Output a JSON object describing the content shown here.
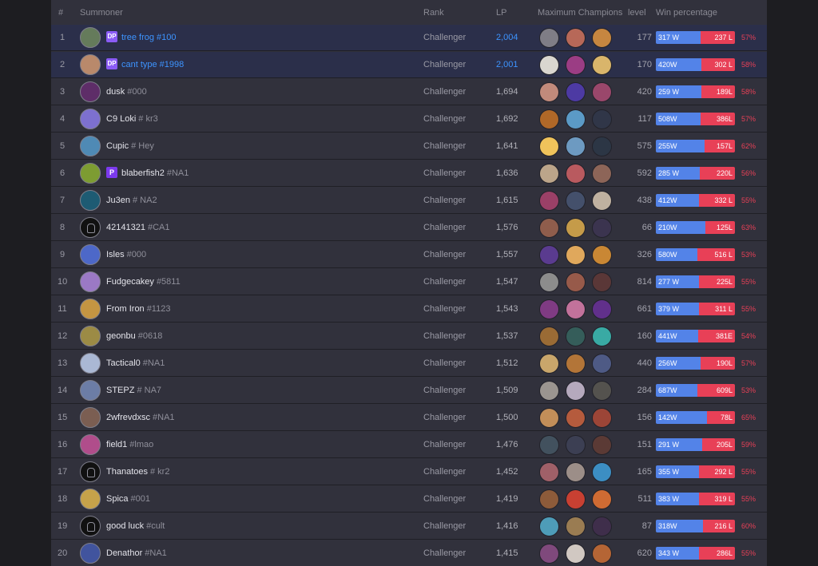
{
  "header": {
    "rank": "#",
    "summoner": "Summoner",
    "tier": "Rank",
    "lp": "LP",
    "champions": "Maximum Champions",
    "level": "level",
    "win": "Win percentage"
  },
  "rows": [
    {
      "rank": "1",
      "name": "tree frog",
      "tag": "#100",
      "badge": "DP",
      "tier": "Challenger",
      "lp": "2,004",
      "level": "177",
      "wins": "317 W",
      "losses": "237 L",
      "pct": "57%",
      "win_rate": 0.57,
      "highlight": true,
      "avatar_icon": "frog-avatar-icon",
      "avatar_color": "#657b5b",
      "champs": [
        {
          "icon": "champion-portrait-icon",
          "color": "#7f7d86"
        },
        {
          "icon": "champion-portrait-icon",
          "color": "#b76858"
        },
        {
          "icon": "champion-portrait-icon",
          "color": "#c68640"
        }
      ]
    },
    {
      "rank": "2",
      "name": "cant type",
      "tag": "#1998",
      "badge": "DP",
      "tier": "Challenger",
      "lp": "2,001",
      "level": "170",
      "wins": "420W",
      "losses": "302 L",
      "pct": "58%",
      "win_rate": 0.58,
      "highlight": true,
      "avatar_icon": "champion-avatar-icon",
      "avatar_color": "#b9896b",
      "champs": [
        {
          "icon": "champion-portrait-icon",
          "color": "#d9d6cf"
        },
        {
          "icon": "champion-portrait-icon",
          "color": "#9b3d84"
        },
        {
          "icon": "champion-portrait-icon",
          "color": "#d9b56b"
        }
      ]
    },
    {
      "rank": "3",
      "name": "dusk",
      "tag": "#000",
      "badge": "",
      "tier": "Challenger",
      "lp": "1,694",
      "level": "420",
      "wins": "259 W",
      "losses": "189L",
      "pct": "58%",
      "win_rate": 0.58,
      "highlight": false,
      "avatar_icon": "champion-avatar-icon",
      "avatar_color": "#5e2d68",
      "champs": [
        {
          "icon": "champion-portrait-icon",
          "color": "#c18a7b"
        },
        {
          "icon": "champion-portrait-icon",
          "color": "#4d3aa3"
        },
        {
          "icon": "champion-portrait-icon",
          "color": "#9a476b"
        }
      ]
    },
    {
      "rank": "4",
      "name": "C9 Loki",
      "tag": "# kr3",
      "badge": "",
      "tier": "Challenger",
      "lp": "1,692",
      "level": "117",
      "wins": "508W",
      "losses": "386L",
      "pct": "57%",
      "win_rate": 0.57,
      "highlight": false,
      "avatar_icon": "champion-avatar-icon",
      "avatar_color": "#7d70cf",
      "champs": [
        {
          "icon": "champion-portrait-icon",
          "color": "#b06828"
        },
        {
          "icon": "champion-portrait-icon",
          "color": "#5b9ac6"
        },
        {
          "icon": "champion-portrait-icon",
          "color": "#303648"
        }
      ]
    },
    {
      "rank": "5",
      "name": "Cupic",
      "tag": "# Hey",
      "badge": "",
      "tier": "Challenger",
      "lp": "1,641",
      "level": "575",
      "wins": "255W",
      "losses": "157L",
      "pct": "62%",
      "win_rate": 0.62,
      "highlight": false,
      "avatar_icon": "champion-avatar-icon",
      "avatar_color": "#4f8ab5",
      "champs": [
        {
          "icon": "champion-portrait-icon",
          "color": "#efc35b"
        },
        {
          "icon": "champion-portrait-icon",
          "color": "#6d9ac1"
        },
        {
          "icon": "champion-portrait-icon",
          "color": "#2c3645"
        }
      ]
    },
    {
      "rank": "6",
      "name": "blaberfish2",
      "tag": "#NA1",
      "badge": "P",
      "tier": "Challenger",
      "lp": "1,636",
      "level": "592",
      "wins": "285 W",
      "losses": "220L",
      "pct": "56%",
      "win_rate": 0.56,
      "highlight": false,
      "avatar_icon": "fish-avatar-icon",
      "avatar_color": "#7d9c32",
      "champs": [
        {
          "icon": "champion-portrait-icon",
          "color": "#bca58a"
        },
        {
          "icon": "champion-portrait-icon",
          "color": "#b95a5f"
        },
        {
          "icon": "champion-portrait-icon",
          "color": "#8d6558"
        }
      ]
    },
    {
      "rank": "7",
      "name": "Ju3en",
      "tag": "# NA2",
      "badge": "",
      "tier": "Challenger",
      "lp": "1,615",
      "level": "438",
      "wins": "412W",
      "losses": "332 L",
      "pct": "55%",
      "win_rate": 0.55,
      "highlight": false,
      "avatar_icon": "champion-avatar-icon",
      "avatar_color": "#1e5b73",
      "champs": [
        {
          "icon": "champion-portrait-icon",
          "color": "#9a4067"
        },
        {
          "icon": "champion-portrait-icon",
          "color": "#44506b"
        },
        {
          "icon": "champion-portrait-icon",
          "color": "#bfb1a0"
        }
      ]
    },
    {
      "rank": "8",
      "name": "42141321",
      "tag": "#CA1",
      "badge": "",
      "tier": "Challenger",
      "lp": "1,576",
      "level": "66",
      "wins": "210W",
      "losses": "125L",
      "pct": "63%",
      "win_rate": 0.63,
      "highlight": false,
      "avatar_icon": "helmet-avatar-icon",
      "avatar_color": "#111111",
      "champs": [
        {
          "icon": "champion-portrait-icon",
          "color": "#8f5d4c"
        },
        {
          "icon": "champion-portrait-icon",
          "color": "#c59b49"
        },
        {
          "icon": "champion-portrait-icon",
          "color": "#3b344f"
        }
      ]
    },
    {
      "rank": "9",
      "name": "Isles",
      "tag": "#000",
      "badge": "",
      "tier": "Challenger",
      "lp": "1,557",
      "level": "326",
      "wins": "580W",
      "losses": "516 L",
      "pct": "53%",
      "win_rate": 0.53,
      "highlight": false,
      "avatar_icon": "champion-avatar-icon",
      "avatar_color": "#4d68c8",
      "champs": [
        {
          "icon": "champion-portrait-icon",
          "color": "#5a3b8f"
        },
        {
          "icon": "champion-portrait-icon",
          "color": "#e0a85c"
        },
        {
          "icon": "champion-portrait-icon",
          "color": "#c98734"
        }
      ]
    },
    {
      "rank": "10",
      "name": "Fudgecakey",
      "tag": "#5811",
      "badge": "",
      "tier": "Challenger",
      "lp": "1,547",
      "level": "814",
      "wins": "277 W",
      "losses": "225L",
      "pct": "55%",
      "win_rate": 0.55,
      "highlight": false,
      "avatar_icon": "champion-avatar-icon",
      "avatar_color": "#9b79c5",
      "champs": [
        {
          "icon": "champion-portrait-icon",
          "color": "#8c8c8c"
        },
        {
          "icon": "champion-portrait-icon",
          "color": "#975a4a"
        },
        {
          "icon": "champion-portrait-icon",
          "color": "#5a3737"
        }
      ]
    },
    {
      "rank": "11",
      "name": "From Iron",
      "tag": "#1123",
      "badge": "",
      "tier": "Challenger",
      "lp": "1,543",
      "level": "661",
      "wins": "379 W",
      "losses": "311 L",
      "pct": "55%",
      "win_rate": 0.55,
      "highlight": false,
      "avatar_icon": "champion-avatar-icon",
      "avatar_color": "#c49542",
      "champs": [
        {
          "icon": "champion-portrait-icon",
          "color": "#7f3b83"
        },
        {
          "icon": "champion-portrait-icon",
          "color": "#c2729b"
        },
        {
          "icon": "champion-portrait-icon",
          "color": "#61308b"
        }
      ]
    },
    {
      "rank": "12",
      "name": "geonbu",
      "tag": "#0618",
      "badge": "",
      "tier": "Challenger",
      "lp": "1,537",
      "level": "160",
      "wins": "441W",
      "losses": "381E",
      "pct": "54%",
      "win_rate": 0.54,
      "highlight": false,
      "avatar_icon": "champion-avatar-icon",
      "avatar_color": "#9c8b45",
      "champs": [
        {
          "icon": "champion-portrait-icon",
          "color": "#9a6b35"
        },
        {
          "icon": "champion-portrait-icon",
          "color": "#355d5a"
        },
        {
          "icon": "champion-portrait-icon",
          "color": "#39aaa4"
        }
      ]
    },
    {
      "rank": "13",
      "name": "Tactical0",
      "tag": "#NA1",
      "badge": "",
      "tier": "Challenger",
      "lp": "1,512",
      "level": "440",
      "wins": "256W",
      "losses": "190L",
      "pct": "57%",
      "win_rate": 0.57,
      "highlight": false,
      "avatar_icon": "champion-avatar-icon",
      "avatar_color": "#aab8d4",
      "champs": [
        {
          "icon": "champion-portrait-icon",
          "color": "#c9a66b"
        },
        {
          "icon": "champion-portrait-icon",
          "color": "#b37538"
        },
        {
          "icon": "champion-portrait-icon",
          "color": "#4e5a85"
        }
      ]
    },
    {
      "rank": "14",
      "name": "STEPZ",
      "tag": "# NA7",
      "badge": "",
      "tier": "Challenger",
      "lp": "1,509",
      "level": "284",
      "wins": "687W",
      "losses": "609L",
      "pct": "53%",
      "win_rate": 0.53,
      "highlight": false,
      "avatar_icon": "champion-avatar-icon",
      "avatar_color": "#6c7da6",
      "champs": [
        {
          "icon": "champion-portrait-icon",
          "color": "#9b9590"
        },
        {
          "icon": "champion-portrait-icon",
          "color": "#b5a9bd"
        },
        {
          "icon": "champion-portrait-icon",
          "color": "#54524e"
        }
      ]
    },
    {
      "rank": "15",
      "name": "2wfrevdxsc",
      "tag": "#NA1",
      "badge": "",
      "tier": "Challenger",
      "lp": "1,500",
      "level": "156",
      "wins": "142W",
      "losses": "78L",
      "pct": "65%",
      "win_rate": 0.65,
      "highlight": false,
      "avatar_icon": "champion-avatar-icon",
      "avatar_color": "#7b5e52",
      "champs": [
        {
          "icon": "champion-portrait-icon",
          "color": "#c28e59"
        },
        {
          "icon": "champion-portrait-icon",
          "color": "#b55b3d"
        },
        {
          "icon": "champion-portrait-icon",
          "color": "#9c4537"
        }
      ]
    },
    {
      "rank": "16",
      "name": "field1",
      "tag": "#lmao",
      "badge": "",
      "tier": "Challenger",
      "lp": "1,476",
      "level": "151",
      "wins": "291 W",
      "losses": "205L",
      "pct": "59%",
      "win_rate": 0.59,
      "highlight": false,
      "avatar_icon": "champion-avatar-icon",
      "avatar_color": "#b04d8b",
      "champs": [
        {
          "icon": "champion-portrait-icon",
          "color": "#42515e"
        },
        {
          "icon": "champion-portrait-icon",
          "color": "#3c3f53"
        },
        {
          "icon": "champion-portrait-icon",
          "color": "#5b3a35"
        }
      ]
    },
    {
      "rank": "17",
      "name": "Thanatoes",
      "tag": "# kr2",
      "badge": "",
      "tier": "Challenger",
      "lp": "1,452",
      "level": "165",
      "wins": "355 W",
      "losses": "292 L",
      "pct": "55%",
      "win_rate": 0.55,
      "highlight": false,
      "avatar_icon": "helmet-avatar-icon",
      "avatar_color": "#111111",
      "champs": [
        {
          "icon": "champion-portrait-icon",
          "color": "#a06068"
        },
        {
          "icon": "champion-portrait-icon",
          "color": "#9c8e88"
        },
        {
          "icon": "champion-portrait-icon",
          "color": "#3c8ec3"
        }
      ]
    },
    {
      "rank": "18",
      "name": "Spica",
      "tag": "#001",
      "badge": "",
      "tier": "Challenger",
      "lp": "1,419",
      "level": "511",
      "wins": "383 W",
      "losses": "319 L",
      "pct": "55%",
      "win_rate": 0.55,
      "highlight": false,
      "avatar_icon": "champion-avatar-icon",
      "avatar_color": "#c6a24a",
      "champs": [
        {
          "icon": "champion-portrait-icon",
          "color": "#8d5b3a"
        },
        {
          "icon": "champion-portrait-icon",
          "color": "#c84032"
        },
        {
          "icon": "champion-portrait-icon",
          "color": "#cf6b33"
        }
      ]
    },
    {
      "rank": "19",
      "name": "good luck",
      "tag": "#cult",
      "badge": "",
      "tier": "Challenger",
      "lp": "1,416",
      "level": "87",
      "wins": "318W",
      "losses": "216 L",
      "pct": "60%",
      "win_rate": 0.6,
      "highlight": false,
      "avatar_icon": "helmet-avatar-icon",
      "avatar_color": "#111111",
      "champs": [
        {
          "icon": "champion-portrait-icon",
          "color": "#4e9cb8"
        },
        {
          "icon": "champion-portrait-icon",
          "color": "#9a7c52"
        },
        {
          "icon": "champion-portrait-icon",
          "color": "#3f2e4b"
        }
      ]
    },
    {
      "rank": "20",
      "name": "Denathor",
      "tag": "#NA1",
      "badge": "",
      "tier": "Challenger",
      "lp": "1,415",
      "level": "620",
      "wins": "343 W",
      "losses": "286L",
      "pct": "55%",
      "win_rate": 0.55,
      "highlight": false,
      "avatar_icon": "champion-avatar-icon",
      "avatar_color": "#41549e",
      "champs": [
        {
          "icon": "champion-portrait-icon",
          "color": "#7f497c"
        },
        {
          "icon": "champion-portrait-icon",
          "color": "#d1c8c2"
        },
        {
          "icon": "champion-portrait-icon",
          "color": "#b56535"
        }
      ]
    }
  ]
}
